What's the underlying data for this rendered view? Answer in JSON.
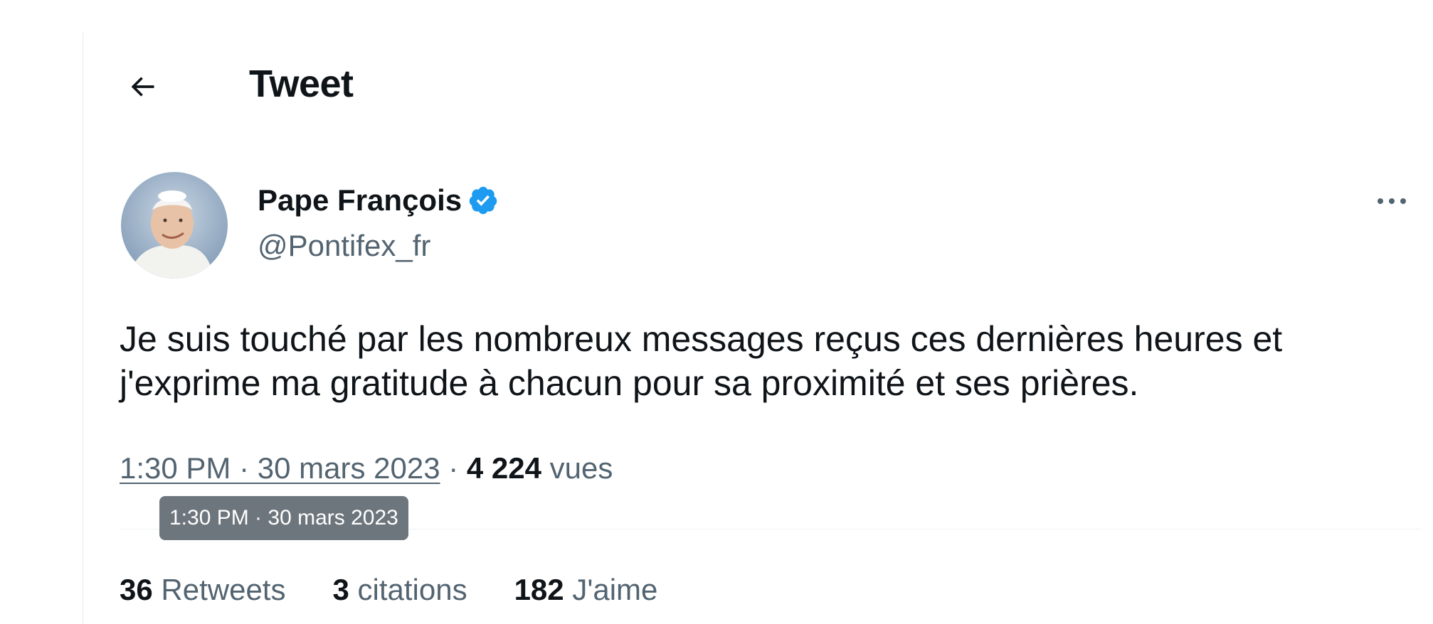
{
  "header": {
    "title": "Tweet",
    "back_icon": "arrow-left-icon"
  },
  "author": {
    "name": "Pape François",
    "handle": "@Pontifex_fr",
    "verified": true,
    "verified_color": "#1d9bf0"
  },
  "tweet": {
    "text": "Je suis touché par les nombreux messages reçus ces dernières heures et j'exprime ma gratitude à chacun pour sa proximité et ses prières.",
    "timestamp": "1:30 PM · 30 mars 2023",
    "separator": " · ",
    "views_count": "4 224",
    "views_label": "vues"
  },
  "tooltip": {
    "text": "1:30 PM · 30 mars 2023"
  },
  "stats": {
    "retweets_count": "36",
    "retweets_label": "Retweets",
    "quotes_count": "3",
    "quotes_label": "citations",
    "likes_count": "182",
    "likes_label": "J'aime"
  },
  "colors": {
    "text_primary": "#0f1419",
    "text_secondary": "#536471",
    "tooltip_bg": "#6e767d",
    "divider": "#eff3f4"
  }
}
